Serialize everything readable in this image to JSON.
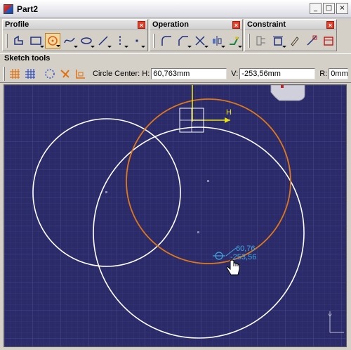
{
  "window": {
    "title": "Part2"
  },
  "window_buttons": {
    "minimize": "_",
    "maximize": "□",
    "close": "×"
  },
  "toolbars": {
    "profile": {
      "title": "Profile"
    },
    "operation": {
      "title": "Operation"
    },
    "constraint": {
      "title": "Constraint"
    }
  },
  "sketch_tools": {
    "title": "Sketch tools",
    "circle_center_label": "Circle Center: H:",
    "h_value": "60,763mm",
    "v_label": "V:",
    "v_value": "-253,56mm",
    "r_label": "R:",
    "r_value": "0mm"
  },
  "canvas": {
    "h_axis_label": "H",
    "cursor_readout_h": "60,76",
    "cursor_readout_v": "-253,56",
    "corner_axis_label": "Y"
  },
  "colors": {
    "canvas_bg": "#2b2b6a",
    "selected_circle": "#e07818",
    "circle": "#ffffff",
    "axis": "#e8e010",
    "readout": "#40a8e0"
  }
}
